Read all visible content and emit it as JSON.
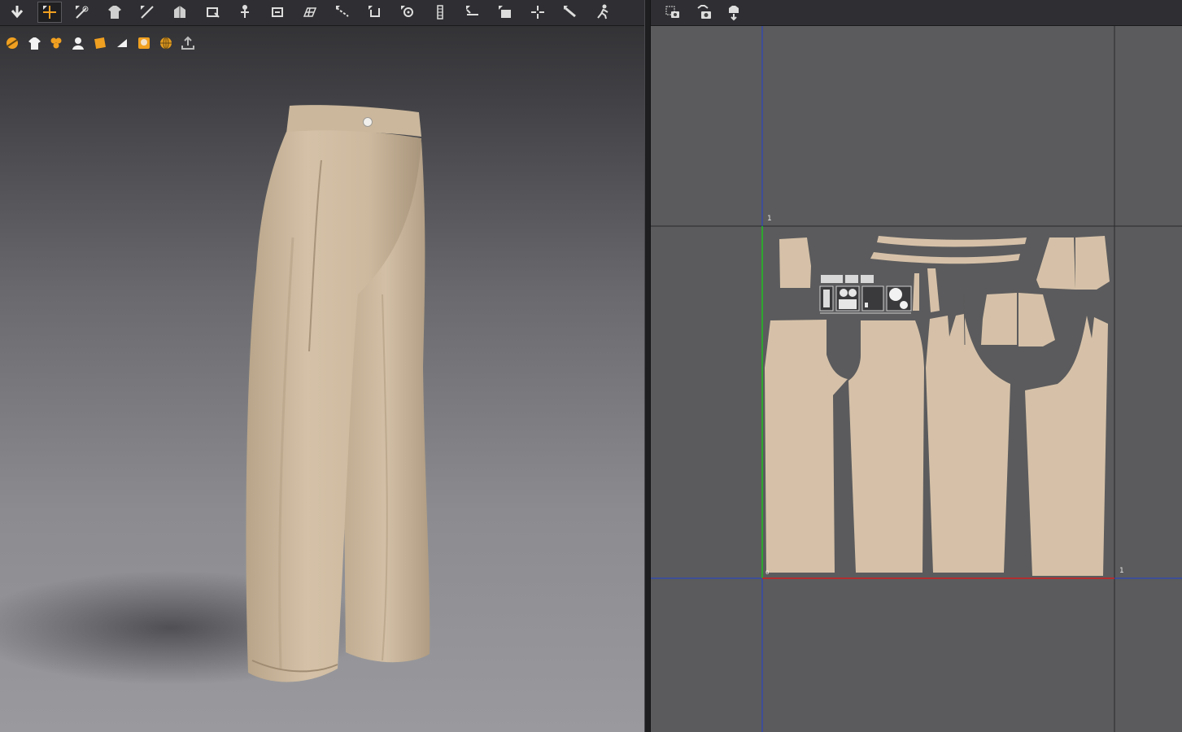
{
  "toolbar_3d": {
    "tools": [
      {
        "icon": "simulation-down-arrow-icon"
      },
      {
        "icon": "move-transform-icon",
        "active": true
      },
      {
        "icon": "select-mesh-icon"
      },
      {
        "icon": "garment-shirt-icon"
      },
      {
        "icon": "draw-line-icon"
      },
      {
        "icon": "fold-arrangement-icon"
      },
      {
        "icon": "pin-icon"
      },
      {
        "icon": "avatar-measure-icon"
      },
      {
        "icon": "tack-icon"
      },
      {
        "icon": "grid-mesh-icon"
      },
      {
        "icon": "seam-line-icon"
      },
      {
        "icon": "hook-tool-icon"
      },
      {
        "icon": "button-tool-icon"
      },
      {
        "icon": "zipper-icon"
      },
      {
        "icon": "elastic-icon"
      },
      {
        "icon": "fabric-stretch-icon"
      },
      {
        "icon": "pin-cloth-icon"
      },
      {
        "icon": "strengthen-icon"
      },
      {
        "icon": "walk-pose-icon"
      }
    ]
  },
  "sub_toolbar_3d": {
    "icons": [
      "avatar-display-icon",
      "garment-display-icon",
      "texture-icon",
      "avatar-silhouette-icon",
      "fabric-render-icon",
      "wireframe-icon",
      "avatar-face-icon",
      "globe-environment-icon",
      "export-icon"
    ]
  },
  "toolbar_2d": {
    "tools": [
      {
        "icon": "snapshot-2d-icon"
      },
      {
        "icon": "snapshot-3d-icon"
      },
      {
        "icon": "arrange-pieces-icon"
      }
    ]
  },
  "sub_toolbar_2d": {
    "icons": [
      "render-sphere-icon",
      "export-pattern-icon"
    ]
  },
  "uv_editor": {
    "labels": {
      "top_left": "1",
      "bottom_right": "1",
      "origin": "0"
    },
    "fabric_color": "#d6c1a8",
    "axis_colors": {
      "x": "#d02020",
      "y": "#20c020",
      "grid_blue": "#2040d0"
    }
  },
  "garment": {
    "name_icon": "wide-leg-trousers-icon",
    "fabric_color": "#d4c0a6"
  }
}
